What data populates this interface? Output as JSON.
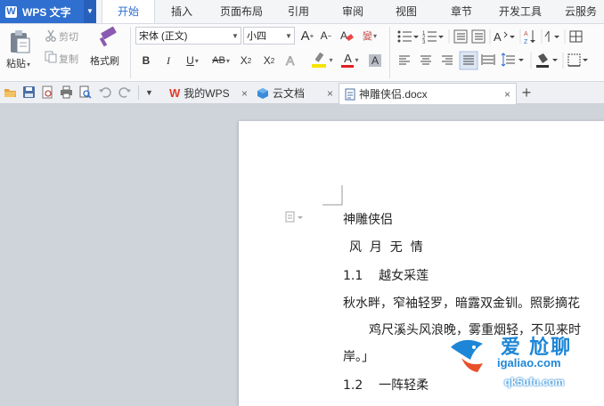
{
  "app": {
    "title": "WPS 文字"
  },
  "menu": {
    "tabs": [
      "开始",
      "插入",
      "页面布局",
      "引用",
      "审阅",
      "视图",
      "章节",
      "开发工具",
      "云服务"
    ],
    "active": "开始"
  },
  "clipboard": {
    "paste": "粘贴",
    "cut": "剪切",
    "copy": "复制",
    "format_painter": "格式刷"
  },
  "font": {
    "name": "宋体 (正文)",
    "size": "小四",
    "increase": "A",
    "decrease": "A"
  },
  "styles": {
    "bold": "B",
    "italic": "I",
    "underline": "U",
    "strike": "AB",
    "superscript": "X",
    "sup_mark": "2",
    "subscript": "X",
    "sub_mark": "2",
    "font_color": "A",
    "clear": "A"
  },
  "tabs": {
    "items": [
      {
        "label": "我的WPS",
        "icon": "wps-logo-icon"
      },
      {
        "label": "云文档",
        "icon": "cloud-cube-icon"
      },
      {
        "label": "神雕侠侣.docx",
        "icon": "document-icon"
      }
    ],
    "active": 2,
    "add": "+"
  },
  "document": {
    "title": "神雕侠侣",
    "subtitle": "风  月  无  情",
    "section1": "1.1    越女采莲",
    "para1_line1": "秋水畔，窄袖轻罗，暗露双金钏。照影摘花",
    "para1_line2": "鸡尺溪头风浪晚，雾重烟轻，不见来时",
    "para1_line3": "岸。」",
    "section2": "1.2    一阵轻柔"
  },
  "watermark": {
    "line1": "爱 尬聊",
    "line2": "igaliao.com",
    "line3": "qk5ufu.com"
  },
  "colors": {
    "accent": "#2f6fcf",
    "workspace": "#cfd3da",
    "highlight": "#f5e400",
    "font_red": "#e02020"
  }
}
